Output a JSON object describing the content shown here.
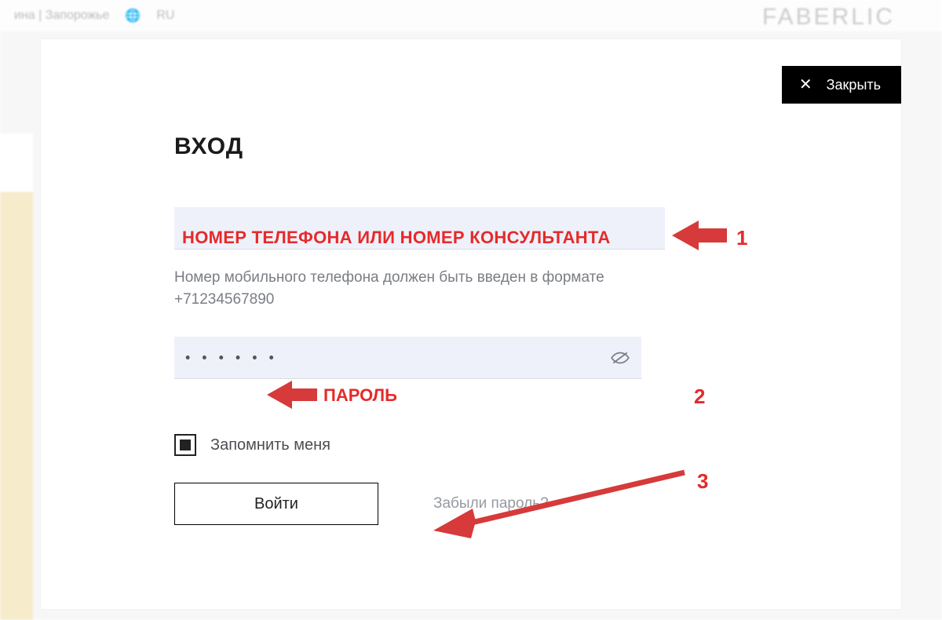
{
  "background": {
    "location_text": "ина | Запорожье",
    "lang": "RU",
    "brand": "FABERLIC"
  },
  "modal": {
    "close_label": "Закрыть",
    "title": "ВХОД",
    "username": {
      "value": "",
      "hint": "Номер мобильного телефона должен быть введен в формате +71234567890"
    },
    "password": {
      "masked": "• • • • • •"
    },
    "remember_label": "Запомнить меня",
    "remember_checked": true,
    "login_label": "Войти",
    "forgot_label": "Забыли пароль?"
  },
  "annotations": {
    "field1_label": "НОМЕР ТЕЛЕФОНА ИЛИ НОМЕР КОНСУЛЬТАНТА",
    "field2_label": "ПАРОЛЬ",
    "n1": "1",
    "n2": "2",
    "n3": "3"
  }
}
